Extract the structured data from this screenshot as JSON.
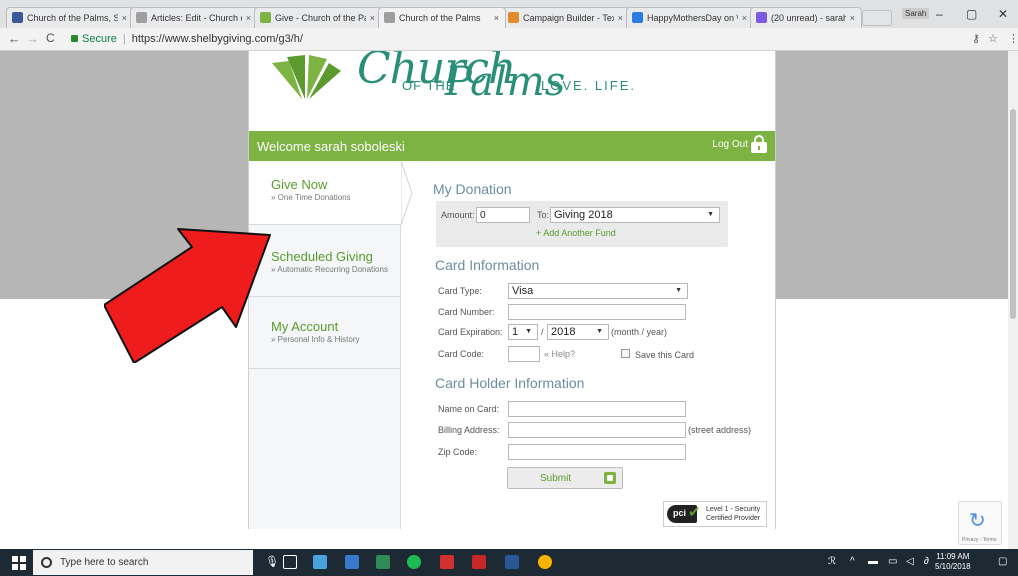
{
  "browser": {
    "tabs": [
      {
        "title": "Church of the Palms, Sa",
        "favicon_color": "#3b5998"
      },
      {
        "title": "Articles: Edit - Church o",
        "favicon_color": "#9e9e9e"
      },
      {
        "title": "Give - Church of the Pa",
        "favicon_color": "#7cb342"
      },
      {
        "title": "Church of the Palms",
        "favicon_color": "#9e9e9e",
        "active": true
      },
      {
        "title": "Campaign Builder - Tex",
        "favicon_color": "#e28b2c"
      },
      {
        "title": "HappyMothersDay on \\",
        "favicon_color": "#2c7be2"
      },
      {
        "title": "(20 unread) - sarahsob",
        "favicon_color": "#7b5be2"
      }
    ],
    "tab_close_glyph": "×",
    "user_chip": "Sarah",
    "window_controls": {
      "minimize": "–",
      "maximize": "▢",
      "close": "✕"
    },
    "nav": {
      "back": "←",
      "forward": "→",
      "reload": "C"
    },
    "address": {
      "secure_label": "Secure",
      "url": "https://www.shelbygiving.com/g3/h/"
    },
    "address_icons": {
      "key": "⚷",
      "star": "☆",
      "menu": "⋮"
    }
  },
  "brand": {
    "script_top": "Church",
    "of_the": "OF THE",
    "script_bottom": "Palms",
    "tagline": "LOVE. LIFE.",
    "accent": "#7cb342",
    "teal": "#2a8f7a"
  },
  "welcome": {
    "text": "Welcome sarah soboleski",
    "logout_label": "Log Out"
  },
  "sidebar": {
    "items": [
      {
        "title": "Give Now",
        "subtitle": "» One Time Donations"
      },
      {
        "title": "Scheduled Giving",
        "subtitle": "» Automatic Recurring Donations"
      },
      {
        "title": "My Account",
        "subtitle": "» Personal Info & History"
      }
    ]
  },
  "donation": {
    "heading": "My Donation",
    "amount_label": "Amount: $",
    "amount_value": "0",
    "to_label": "To:",
    "fund_selected": "Giving 2018",
    "add_fund": "+ Add Another Fund"
  },
  "card_info": {
    "heading": "Card Information",
    "type_label": "Card Type:",
    "type_value": "Visa",
    "number_label": "Card Number:",
    "number_value": "",
    "expiration_label": "Card Expiration:",
    "exp_month": "1",
    "exp_slash": "/",
    "exp_year": "2018",
    "exp_hint": "(month / year)",
    "code_label": "Card Code:",
    "code_value": "",
    "help_link": "« Help?",
    "save_label": "Save this Card"
  },
  "holder_info": {
    "heading": "Card Holder Information",
    "name_label": "Name on Card:",
    "name_value": "",
    "address_label": "Billing Address:",
    "address_value": "",
    "address_hint": "(street address)",
    "zip_label": "Zip Code:",
    "zip_value": ""
  },
  "submit_label": "Submit",
  "pci": {
    "logo": "pci",
    "line1": "Level 1 - Security",
    "line2": "Certified Provider"
  },
  "recaptcha": {
    "footer": "Privacy - Terms"
  },
  "taskbar": {
    "search_placeholder": "Type here to search",
    "clock_time": "11:09 AM",
    "clock_date": "5/10/2018",
    "app_icon_colors": [
      "#4aa3df",
      "#3a78c9",
      "#2e8b57",
      "#1db954",
      "#d32f2f",
      "#c62828",
      "#2b579a",
      "#f4b400"
    ]
  }
}
